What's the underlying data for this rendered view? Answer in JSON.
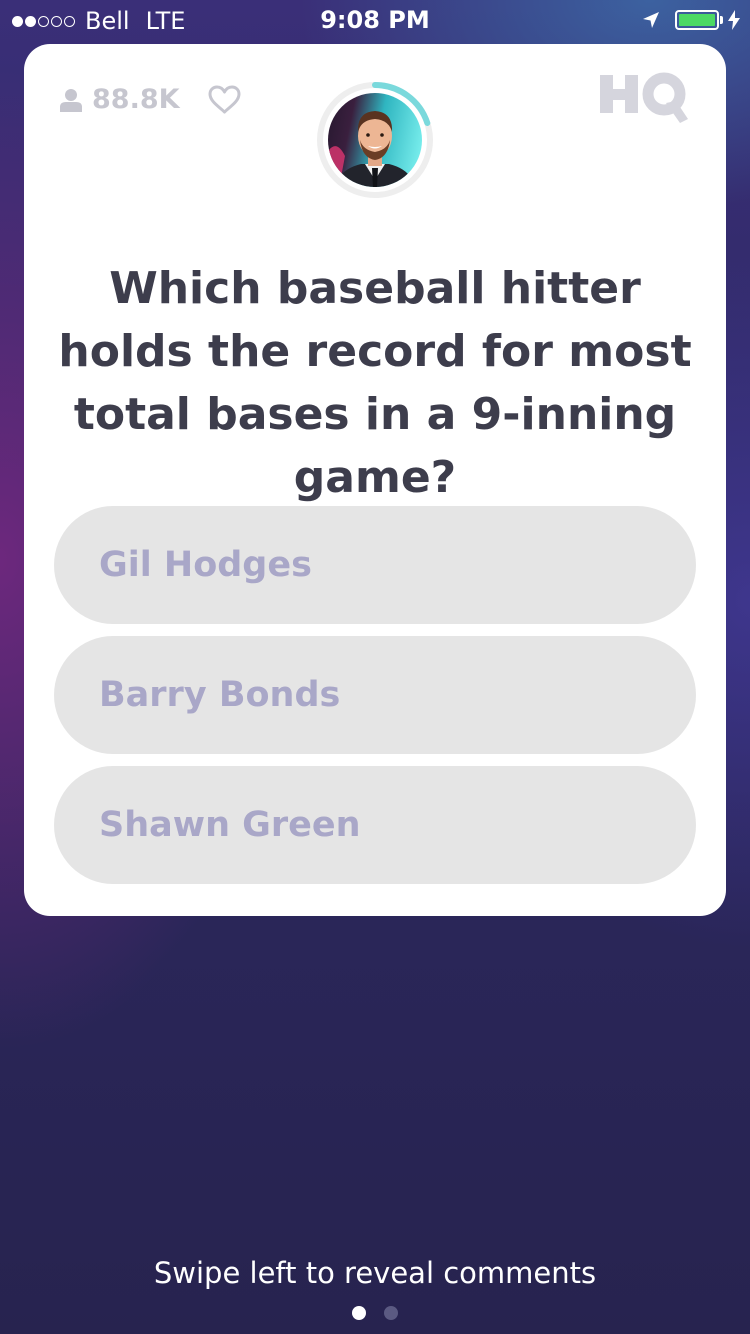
{
  "status_bar": {
    "signal_dots": {
      "filled": 2,
      "total": 5
    },
    "carrier": "Bell",
    "network": "LTE",
    "time": "9:08 PM",
    "battery_level": 1.0,
    "battery_color": "#4cd964",
    "icons": [
      "signal-dots",
      "location-arrow-icon",
      "battery-icon",
      "charging-bolt-icon"
    ]
  },
  "game": {
    "viewer_count": "88.8K",
    "logo": "HQ",
    "host_avatar": "host-photo",
    "timer_remaining": 0.2,
    "timer_color": "#7ad9dc",
    "question": "Which baseball hitter holds the record for most total bases in a 9-inning game?",
    "answers": [
      {
        "label": "Gil Hodges"
      },
      {
        "label": "Barry Bonds"
      },
      {
        "label": "Shawn Green"
      }
    ]
  },
  "footer": {
    "hint": "Swipe left to reveal comments",
    "pages": {
      "count": 2,
      "active": 1
    }
  },
  "colors": {
    "card_background": "#ffffff",
    "question_text": "#3d3d4c",
    "answer_background": "#e5e5e5",
    "answer_text": "#a9a7c8",
    "muted_icon": "#c6c6cf"
  }
}
